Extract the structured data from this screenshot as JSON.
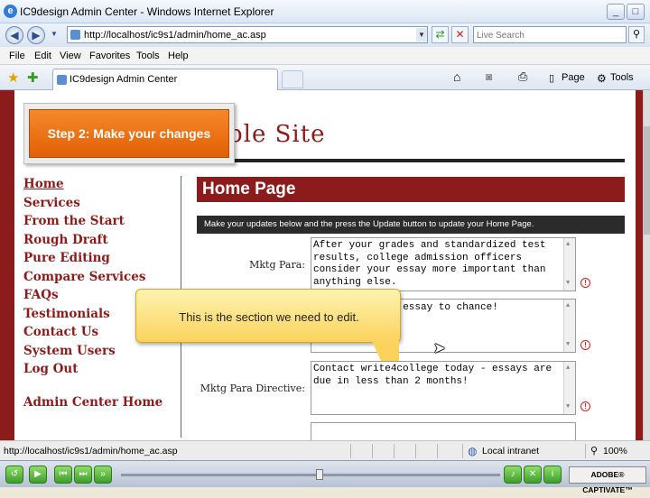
{
  "window": {
    "title": "IC9design Admin Center - Windows Internet Explorer",
    "minimize": "_",
    "maximize": "□",
    "close": "×"
  },
  "address": {
    "url": "http://localhost/ic9s1/admin/home_ac.asp",
    "search_placeholder": "Live Search"
  },
  "menu": [
    "File",
    "Edit",
    "View",
    "Favorites",
    "Tools",
    "Help"
  ],
  "tab": {
    "label": "IC9design Admin Center"
  },
  "commandbar": {
    "page_label": "Page",
    "tools_label": "Tools"
  },
  "site": {
    "title_fragment": "ple Site",
    "step_label": "Step 2: Make your changes",
    "nav": [
      "Home",
      "Services",
      "From the Start",
      "Rough Draft",
      "Pure Editing",
      "Compare Services",
      "FAQs",
      "Testimonials",
      "Contact Us",
      "System Users",
      "Log Out"
    ],
    "nav_admin": "Admin Center Home",
    "heading": "Home Page",
    "instructions": "Make your updates below and the press the Update button to update your Home Page.",
    "fields": [
      {
        "label": "Mktg Para:",
        "value": "After your grades and standardized test results, college admission officers consider your essay more important than anything else."
      },
      {
        "label": "",
        "value": "r essay to chance!"
      },
      {
        "label": "Mktg Para Directive:",
        "value": "Contact write4college today - essays are due in less than 2 months!"
      },
      {
        "label": "",
        "value": ""
      }
    ]
  },
  "callout": {
    "text": "This is the section we need to edit."
  },
  "status": {
    "url": "http://localhost/ic9s1/admin/home_ac.asp",
    "zone": "Local intranet",
    "zoom": "100%"
  },
  "captivate": {
    "logo": "ADOBE® CAPTIVATE™"
  }
}
